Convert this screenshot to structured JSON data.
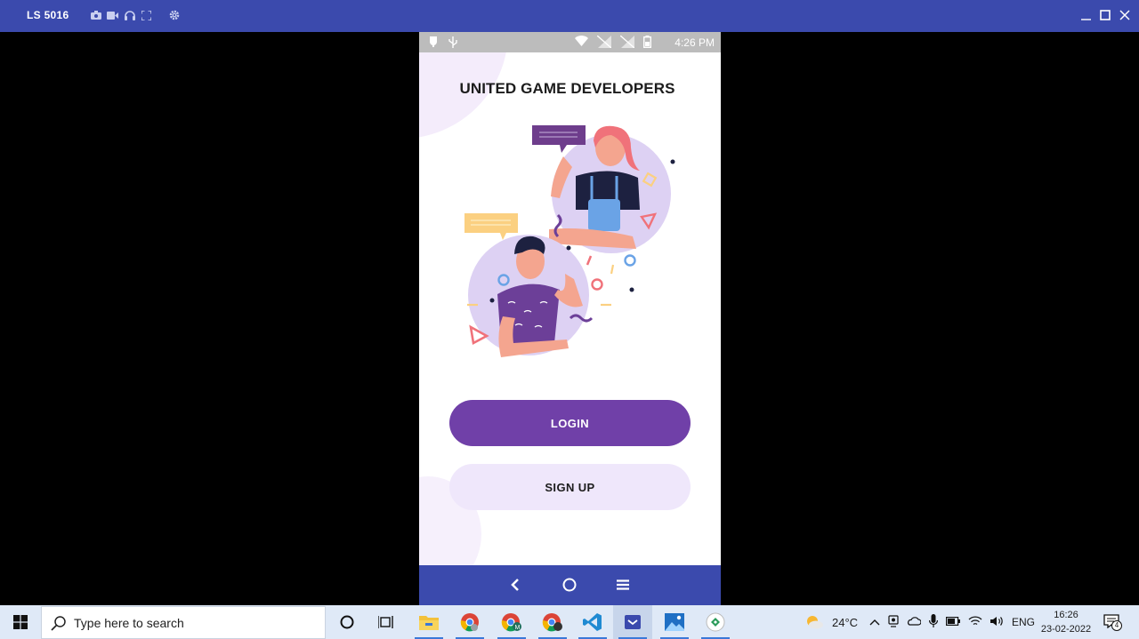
{
  "titlebar": {
    "device_name": "LS 5016",
    "icons": [
      "camera-icon",
      "video-icon",
      "headphones-icon",
      "fullscreen-icon",
      "settings-icon"
    ],
    "window_controls": [
      "minimize-icon",
      "maximize-icon",
      "close-icon"
    ]
  },
  "statusbar": {
    "left_icons": [
      "notification-icon",
      "usb-icon"
    ],
    "right_icons": [
      "wifi-icon",
      "no-sim-icon",
      "no-sim-icon",
      "battery-icon"
    ],
    "time": "4:26 PM"
  },
  "app": {
    "title": "UNITED GAME DEVELOPERS",
    "login_label": "LOGIN",
    "signup_label": "SIGN UP",
    "accent_color": "#7040a8",
    "secondary_button_color": "#efe7fb"
  },
  "navbar": {
    "buttons": [
      "back-icon",
      "home-icon",
      "menu-icon"
    ]
  },
  "taskbar": {
    "search_placeholder": "Type here to search",
    "apps": [
      "cortana-icon",
      "task-view-icon",
      "file-explorer-icon",
      "chrome-icon",
      "chrome-profile-icon",
      "chrome-profile-2-icon",
      "vscode-icon",
      "emulator-icon",
      "photos-icon",
      "remote-app-icon"
    ],
    "weather": "24°C",
    "language": "ENG",
    "time": "16:26",
    "date": "23-02-2022",
    "notifications": "4"
  }
}
